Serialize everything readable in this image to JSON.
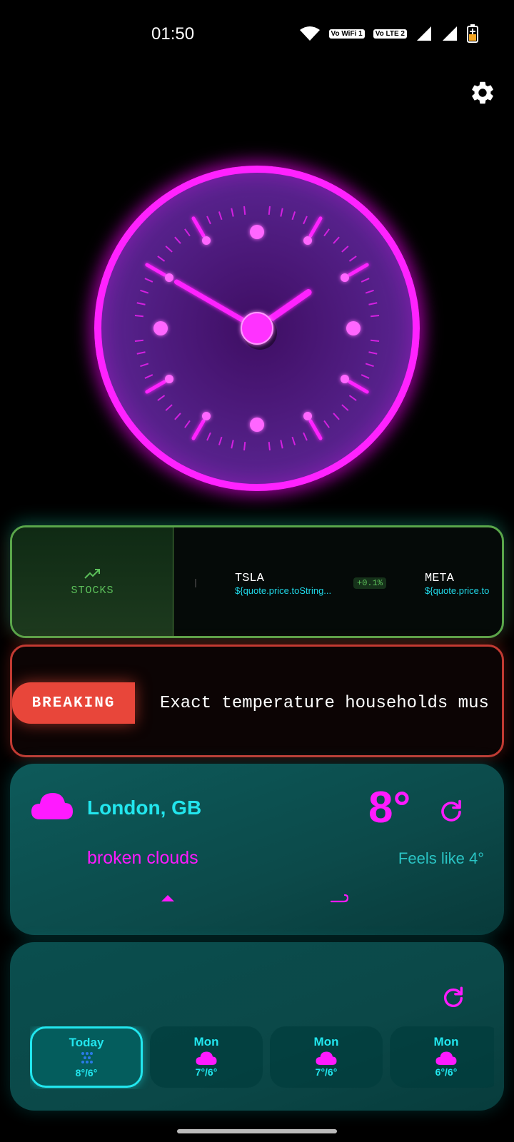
{
  "status_bar": {
    "time": "01:50",
    "badges": [
      "Vo WiFi 1",
      "Vo LTE 2"
    ],
    "icons": [
      "wifi-icon",
      "signal-icon",
      "signal-icon",
      "battery-charging-icon"
    ]
  },
  "settings": {
    "icon": "gear-icon"
  },
  "clock": {
    "time_shown": "01:50",
    "face_color": "#531f86",
    "accent": "#ff22ff"
  },
  "stocks": {
    "label": "STOCKS",
    "icon": "trending-up-icon",
    "tickers": [
      {
        "symbol": "TSLA",
        "price": "${quote.price.toString...",
        "change": "+0.1%"
      },
      {
        "symbol": "META",
        "price": "${quote.price.to"
      }
    ],
    "accent": "#5cc05a"
  },
  "news": {
    "badge": "BREAKING",
    "headline": "Exact temperature households mus",
    "accent": "#e8463a"
  },
  "weather": {
    "city": "London, GB",
    "temperature": "8°",
    "description": "broken clouds",
    "feels_like": "Feels like 4°",
    "icon": "cloud-icon",
    "primary_color": "#22e6ee",
    "secondary_color": "#ff1aff"
  },
  "forecast": {
    "days": [
      {
        "name": "Today",
        "temps": "8°/6°",
        "icon": "rain-icon",
        "active": true
      },
      {
        "name": "Mon",
        "temps": "7°/6°",
        "icon": "cloud-icon",
        "active": false
      },
      {
        "name": "Mon",
        "temps": "7°/6°",
        "icon": "cloud-icon",
        "active": false
      },
      {
        "name": "Mon",
        "temps": "6°/6°",
        "icon": "cloud-icon",
        "active": false
      }
    ]
  }
}
